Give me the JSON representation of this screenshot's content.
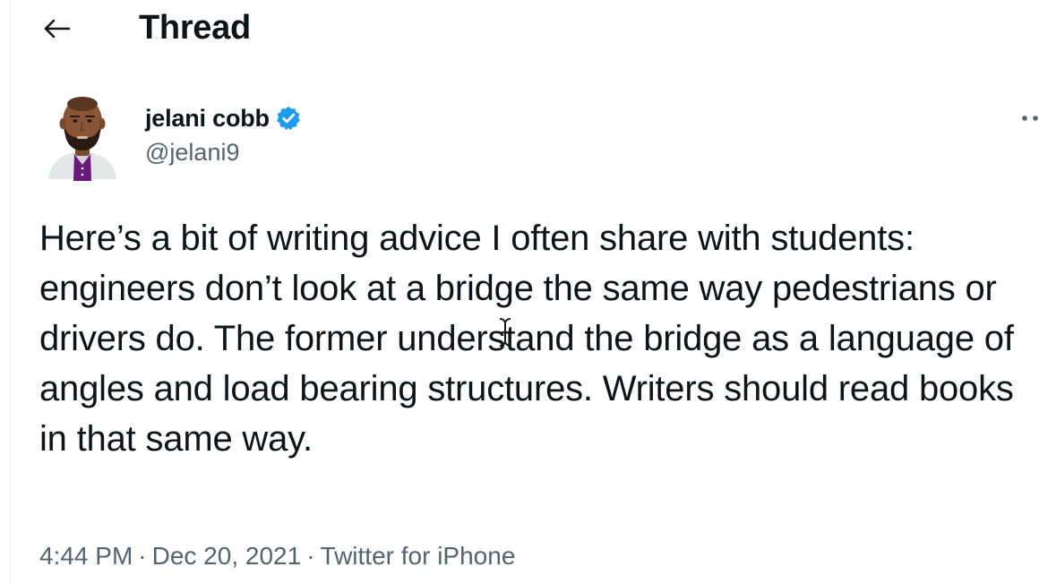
{
  "header": {
    "title": "Thread",
    "back_icon": "arrow-left-icon"
  },
  "author": {
    "display_name": "jelani cobb",
    "handle": "@jelani9",
    "verified": true,
    "verified_color": "#1d9bf0",
    "avatar_icon": "user-avatar-illustration"
  },
  "tweet": {
    "text": "Here’s a bit of writing advice I often share with students: engineers don’t look at a bridge the same way pedestrians or drivers do. The former understand the bridge as a language of angles and load bearing structures. Writers should read books in that same way."
  },
  "meta": {
    "time": "4:44 PM",
    "date": "Dec 20, 2021",
    "source": "Twitter for iPhone",
    "separator": "·"
  },
  "colors": {
    "text_primary": "#0f1419",
    "text_secondary": "#536471",
    "accent": "#1d9bf0"
  },
  "icons": {
    "more": "more-horizontal-icon",
    "text_cursor": "text-cursor-icon"
  }
}
